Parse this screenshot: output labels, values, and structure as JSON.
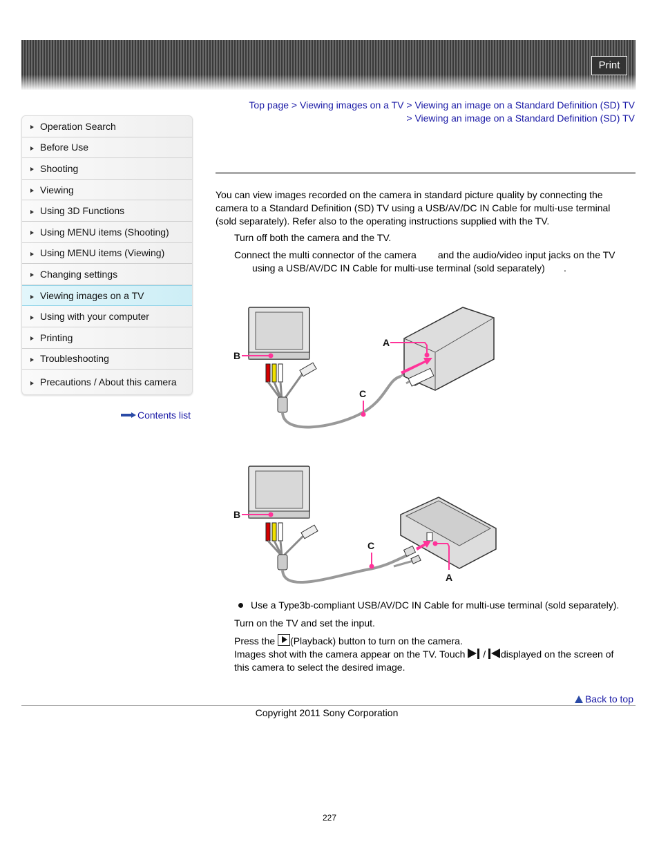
{
  "header": {
    "print_label": "Print"
  },
  "sidebar": {
    "items": [
      {
        "label": "Operation Search",
        "active": false
      },
      {
        "label": "Before Use",
        "active": false
      },
      {
        "label": "Shooting",
        "active": false
      },
      {
        "label": "Viewing",
        "active": false
      },
      {
        "label": "Using 3D Functions",
        "active": false
      },
      {
        "label": "Using MENU items (Shooting)",
        "active": false
      },
      {
        "label": "Using MENU items (Viewing)",
        "active": false
      },
      {
        "label": "Changing settings",
        "active": false
      },
      {
        "label": "Viewing images on a TV",
        "active": true
      },
      {
        "label": "Using with your computer",
        "active": false
      },
      {
        "label": "Printing",
        "active": false
      },
      {
        "label": "Troubleshooting",
        "active": false
      },
      {
        "label": "Precautions / About this camera",
        "active": false
      }
    ],
    "contents_link": "Contents list"
  },
  "breadcrumb": {
    "items": [
      "Top page",
      "Viewing images on a TV",
      "Viewing an image on a Standard Definition (SD) TV",
      "Viewing an image on a Standard Definition (SD) TV"
    ],
    "separator": ">"
  },
  "content": {
    "intro": "You can view images recorded on the camera in standard picture quality by connecting the camera to a Standard Definition (SD) TV using a USB/AV/DC IN Cable for multi-use terminal (sold separately). Refer also to the operating instructions supplied with the TV.",
    "step1": "Turn off both the camera and the TV.",
    "step2_line1": "Connect the multi connector of the camera        and the audio/video input jacks on the TV",
    "step2_line2": "using a USB/AV/DC IN Cable for multi-use terminal (sold separately)       .",
    "diagram_labels": {
      "a": "A",
      "b": "B",
      "c": "C"
    },
    "note": "Use a Type3b-compliant USB/AV/DC IN Cable for multi-use terminal (sold separately).",
    "step3": "Turn on the TV and set the input.",
    "step4_pre": "Press the",
    "step4_post": "(Playback) button to turn on the camera.",
    "step4_line2_pre": "Images shot with the camera appear on the TV. Touch",
    "step4_slash": "/",
    "step4_line2_post": "displayed on the screen of",
    "step4_line3": "this camera to select the desired image."
  },
  "footer": {
    "back_to_top": "Back to top",
    "copyright": "Copyright 2011 Sony Corporation",
    "page_number": "227"
  },
  "colors": {
    "link": "#1a1aa6",
    "callout": "#ff3399",
    "active_nav": "#d6f1f8"
  }
}
